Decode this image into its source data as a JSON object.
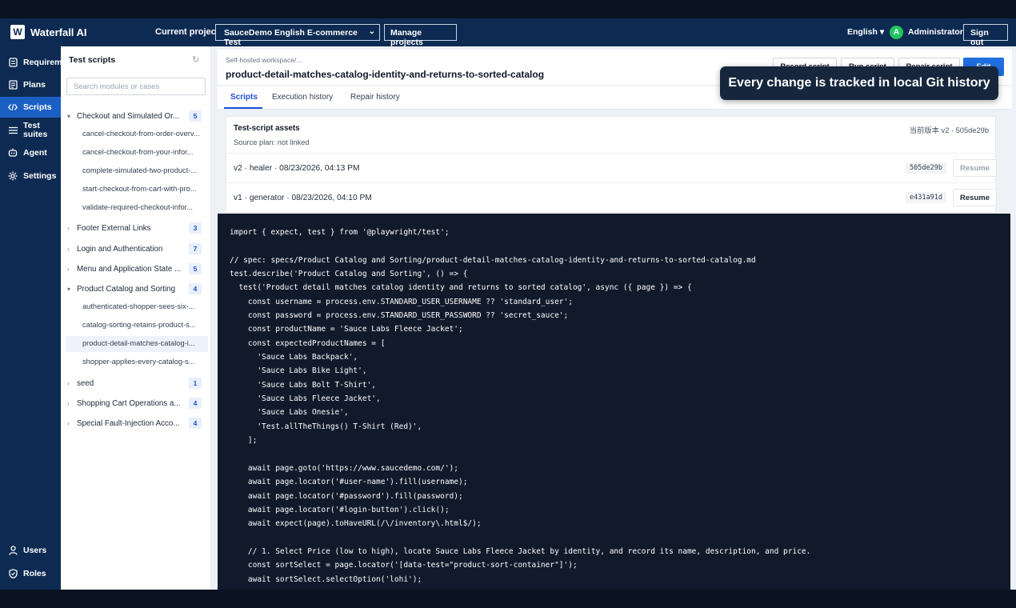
{
  "app": {
    "logo_letter": "W",
    "name": "Waterfall AI"
  },
  "topbar": {
    "current_project_label": "Current project",
    "project_name": "SauceDemo English E-commerce Test",
    "manage_projects": "Manage projects",
    "language": "English ▾",
    "user_initial": "A",
    "user_name": "Administrator",
    "sign_out": "Sign out"
  },
  "nav": {
    "items": [
      {
        "label": "Requirements",
        "icon": "file-icon"
      },
      {
        "label": "Plans",
        "icon": "plan-icon"
      },
      {
        "label": "Scripts",
        "icon": "code-icon",
        "active": true
      },
      {
        "label": "Test suites",
        "icon": "list-icon"
      },
      {
        "label": "Agent",
        "icon": "robot-icon"
      },
      {
        "label": "Settings",
        "icon": "gear-icon"
      }
    ],
    "bottom": [
      {
        "label": "Users",
        "icon": "user-icon"
      },
      {
        "label": "Roles",
        "icon": "shield-icon"
      }
    ]
  },
  "tree": {
    "title": "Test scripts",
    "search_placeholder": "Search modules or cases",
    "groups": [
      {
        "name": "Checkout and Simulated Or...",
        "count": "5",
        "expanded": true,
        "children": [
          "cancel-checkout-from-order-overv...",
          "cancel-checkout-from-your-infor...",
          "complete-simulated-two-product-...",
          "start-checkout-from-cart-with-pro...",
          "validate-required-checkout-infor..."
        ]
      },
      {
        "name": "Footer External Links",
        "count": "3",
        "expanded": false,
        "children": []
      },
      {
        "name": "Login and Authentication",
        "count": "7",
        "expanded": false,
        "children": []
      },
      {
        "name": "Menu and Application State ...",
        "count": "5",
        "expanded": false,
        "children": []
      },
      {
        "name": "Product Catalog and Sorting",
        "count": "4",
        "expanded": true,
        "children": [
          "authenticated-shopper-sees-six-...",
          "catalog-sorting-retains-product-s...",
          "product-detail-matches-catalog-i...",
          "shopper-applies-every-catalog-s..."
        ]
      },
      {
        "name": "seed",
        "count": "1",
        "expanded": false,
        "children": []
      },
      {
        "name": "Shopping Cart Operations a...",
        "count": "4",
        "expanded": false,
        "children": []
      },
      {
        "name": "Special Fault-Injection Acco...",
        "count": "4",
        "expanded": false,
        "children": []
      }
    ]
  },
  "script": {
    "breadcrumb": "Self-hosted workspace/...",
    "title": "product-detail-matches-catalog-identity-and-returns-to-sorted-catalog",
    "buttons": {
      "record": "Record script",
      "run": "Run script",
      "repair": "Repair script",
      "edit": "Edit"
    },
    "tabs": [
      "Scripts",
      "Execution history",
      "Repair history"
    ],
    "assets": {
      "title": "Test-script assets",
      "source_plan": "Source plan: not linked",
      "current_version": "当前版本 v2 · 505de29b",
      "versions": [
        {
          "text": "v2 · healer · 08/23/2026, 04:13 PM",
          "hash": "505de29b",
          "resume": "Resume"
        },
        {
          "text": "v1 · generator · 08/23/2026, 04:10 PM",
          "hash": "e431a91d",
          "resume": "Resume"
        }
      ]
    },
    "code": "import { expect, test } from '@playwright/test';\n\n// spec: specs/Product Catalog and Sorting/product-detail-matches-catalog-identity-and-returns-to-sorted-catalog.md\ntest.describe('Product Catalog and Sorting', () => {\n  test('Product detail matches catalog identity and returns to sorted catalog', async ({ page }) => {\n    const username = process.env.STANDARD_USER_USERNAME ?? 'standard_user';\n    const password = process.env.STANDARD_USER_PASSWORD ?? 'secret_sauce';\n    const productName = 'Sauce Labs Fleece Jacket';\n    const expectedProductNames = [\n      'Sauce Labs Backpack',\n      'Sauce Labs Bike Light',\n      'Sauce Labs Bolt T-Shirt',\n      'Sauce Labs Fleece Jacket',\n      'Sauce Labs Onesie',\n      'Test.allTheThings() T-Shirt (Red)',\n    ];\n\n    await page.goto('https://www.saucedemo.com/');\n    await page.locator('#user-name').fill(username);\n    await page.locator('#password').fill(password);\n    await page.locator('#login-button').click();\n    await expect(page).toHaveURL(/\\/inventory\\.html$/);\n\n    // 1. Select Price (low to high), locate Sauce Labs Fleece Jacket by identity, and record its name, description, and price.\n    const sortSelect = page.locator('[data-test=\"product-sort-container\"]');\n    await sortSelect.selectOption('lohi');"
  },
  "toast": "Every change is tracked in local Git history"
}
